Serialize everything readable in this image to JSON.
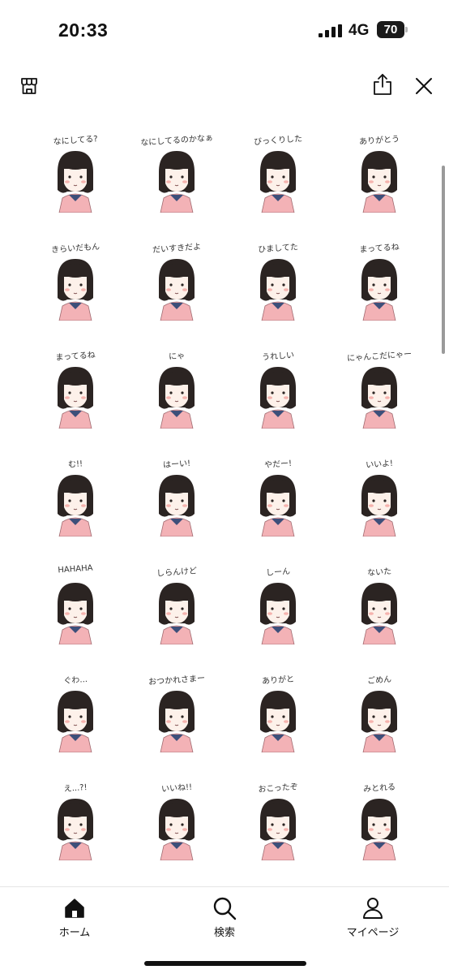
{
  "status_bar": {
    "time": "20:33",
    "network": "4G",
    "battery": "70",
    "signal_icon": "cellular-signal-icon",
    "battery_icon": "battery-icon"
  },
  "toolbar": {
    "left_icon": "shop-icon",
    "share_icon": "share-icon",
    "close_icon": "close-icon"
  },
  "stickers": [
    {
      "caption": "なにしてる?"
    },
    {
      "caption": "なにしてるのかなぁ"
    },
    {
      "caption": "びっくりした"
    },
    {
      "caption": "ありがとう"
    },
    {
      "caption": "きらいだもん"
    },
    {
      "caption": "だいすきだよ"
    },
    {
      "caption": "ひましてた"
    },
    {
      "caption": "まってるね"
    },
    {
      "caption": "まってるね"
    },
    {
      "caption": "にゃ"
    },
    {
      "caption": "うれしい"
    },
    {
      "caption": "にゃんこだにゃー"
    },
    {
      "caption": "む!!"
    },
    {
      "caption": "はーい!"
    },
    {
      "caption": "やだー!"
    },
    {
      "caption": "いいよ!"
    },
    {
      "caption": "HAHAHA"
    },
    {
      "caption": "しらんけど"
    },
    {
      "caption": "しーん"
    },
    {
      "caption": "ないた"
    },
    {
      "caption": "ぐわ..."
    },
    {
      "caption": "おつかれさまー"
    },
    {
      "caption": "ありがと"
    },
    {
      "caption": "ごめん"
    },
    {
      "caption": "え...?!"
    },
    {
      "caption": "いいね!!"
    },
    {
      "caption": "おこったぞ"
    },
    {
      "caption": "みとれる"
    }
  ],
  "bottom_nav": [
    {
      "label": "ホーム",
      "icon": "home-icon"
    },
    {
      "label": "検索",
      "icon": "search-icon"
    },
    {
      "label": "マイページ",
      "icon": "person-icon"
    }
  ],
  "colors": {
    "hair": "#2b2422",
    "jacket": "#f3b2b6",
    "collar": "#3d4f7a",
    "skin": "#fdf1ea",
    "blush": "#f5b3ae"
  }
}
